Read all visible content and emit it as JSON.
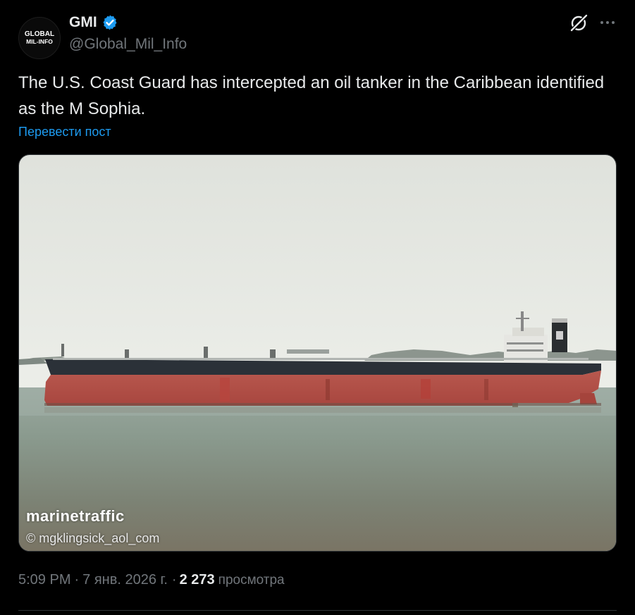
{
  "author": {
    "display_name": "GMI",
    "handle": "@Global_Mil_Info",
    "avatar_text_top": "GLOBAL",
    "avatar_text_bottom": "MIL-INFO",
    "verified": true
  },
  "post": {
    "text": "The U.S. Coast Guard has intercepted an oil tanker in the Caribbean identified as the M Sophia.",
    "translate_label": "Перевести пост"
  },
  "media": {
    "watermark": "marinetraffic",
    "credit": "© mgklingsick_aol_com"
  },
  "meta": {
    "time": "5:09 PM",
    "separator1": "·",
    "date": "7 янв. 2026 г.",
    "separator2": "·",
    "views_count": "2 273",
    "views_label": "просмотра"
  },
  "icons": {
    "verified": "verified-badge-icon",
    "grok": "grok-icon",
    "more": "more-horizontal-icon"
  },
  "colors": {
    "background": "#000000",
    "text_primary": "#e7e9ea",
    "text_secondary": "#71767b",
    "link": "#1d9bf0",
    "verified": "#1d9bf0"
  }
}
